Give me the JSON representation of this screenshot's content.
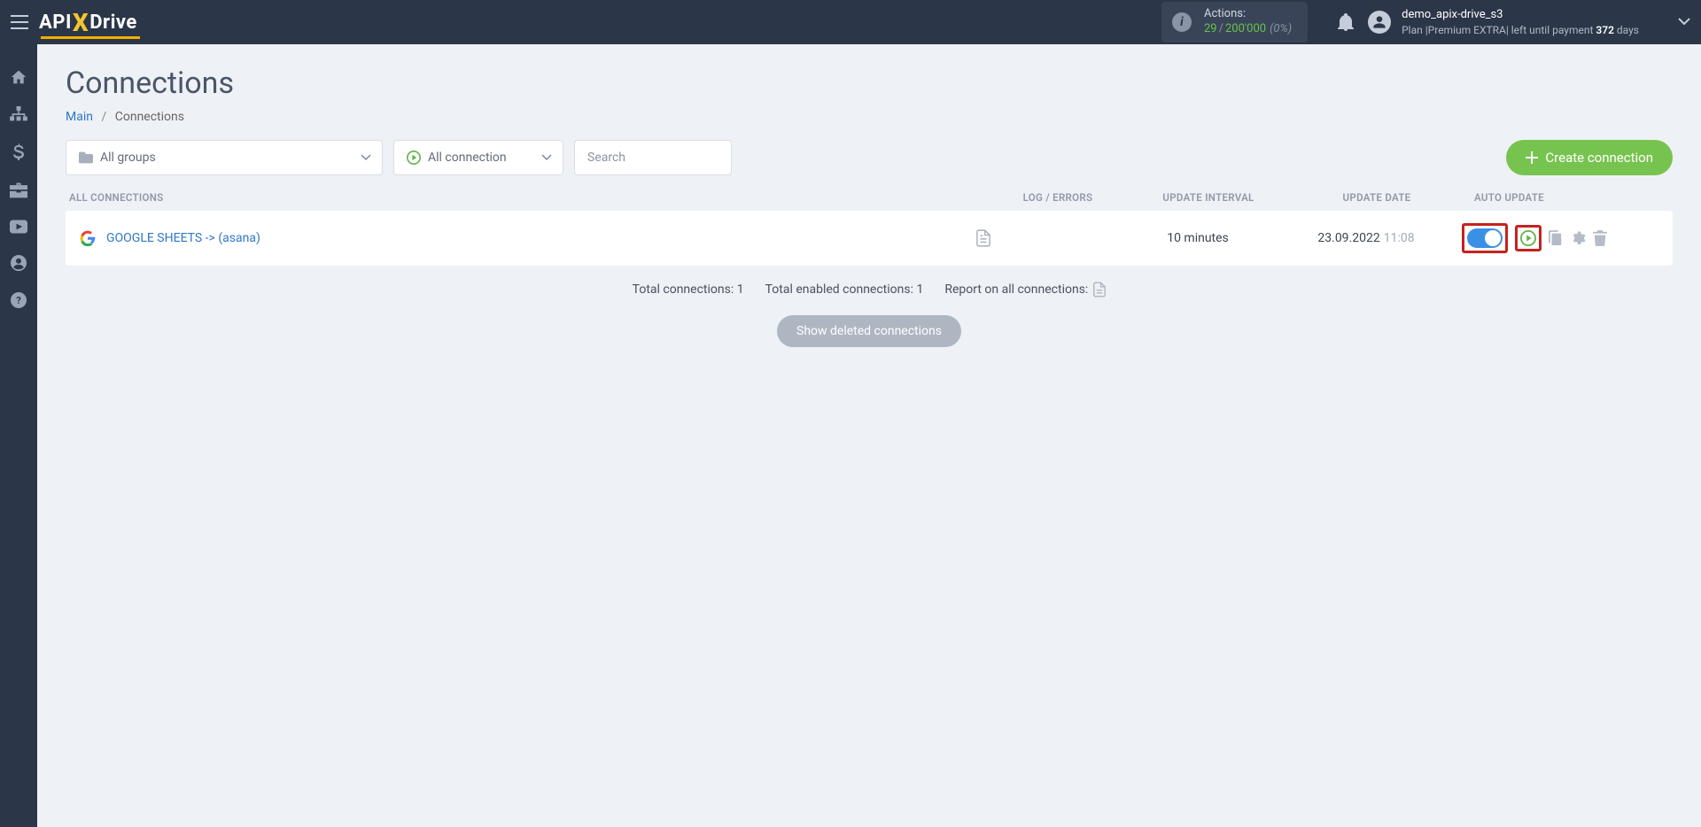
{
  "header": {
    "logo_pre": "API",
    "logo_x": "X",
    "logo_post": "Drive",
    "actions_label": "Actions:",
    "actions_used": "29",
    "actions_slash": "/",
    "actions_limit": "200'000",
    "actions_pct": "(0%)",
    "username": "demo_apix-drive_s3",
    "plan_prefix": "Plan |",
    "plan_name": "Premium EXTRA",
    "plan_suffix": "| left until payment ",
    "plan_days": "372",
    "plan_days_word": " days"
  },
  "page": {
    "title": "Connections",
    "breadcrumb_main": "Main",
    "breadcrumb_current": "Connections"
  },
  "toolbar": {
    "groups_label": "All groups",
    "status_label": "All connection",
    "search_placeholder": "Search",
    "create_label": "Create connection"
  },
  "table": {
    "headers": {
      "all": "ALL CONNECTIONS",
      "log": "LOG / ERRORS",
      "interval": "UPDATE INTERVAL",
      "date": "UPDATE DATE",
      "auto": "AUTO UPDATE"
    },
    "rows": [
      {
        "name": "GOOGLE SHEETS -> (asana)",
        "interval": "10 minutes",
        "date": "23.09.2022",
        "time": "11:08"
      }
    ]
  },
  "summary": {
    "total_label": "Total connections: ",
    "total_value": "1",
    "enabled_label": "Total enabled connections: ",
    "enabled_value": "1",
    "report_label": "Report on all connections:"
  },
  "buttons": {
    "show_deleted": "Show deleted connections"
  }
}
